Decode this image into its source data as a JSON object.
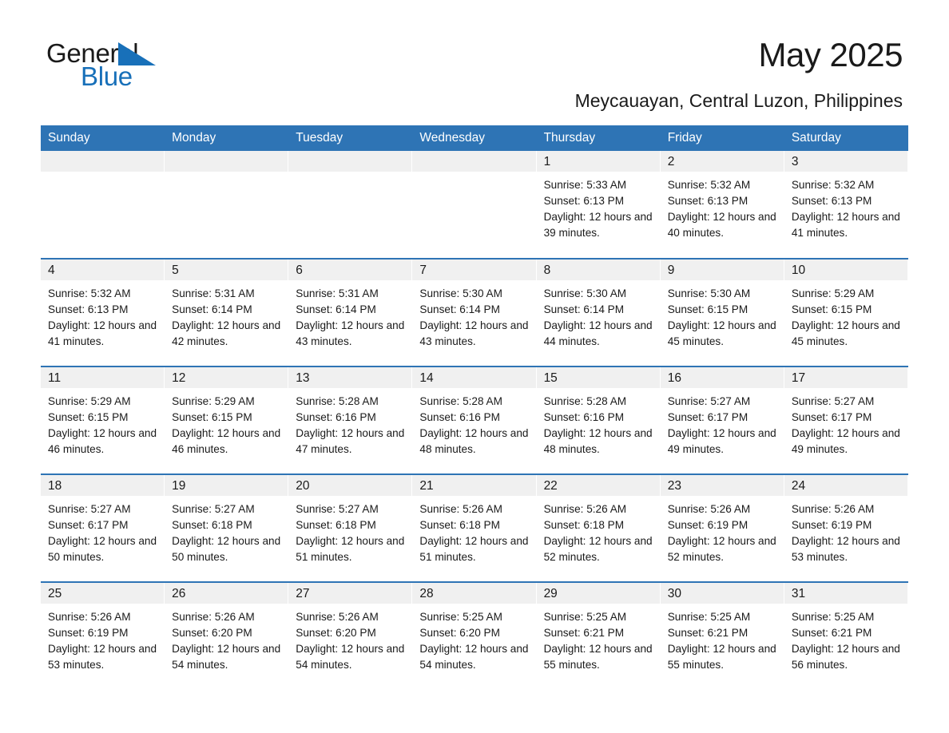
{
  "brand": {
    "name_part1": "General",
    "name_part2": "Blue",
    "triangle_color": "#1870b9"
  },
  "header": {
    "title": "May 2025",
    "subtitle": "Meycauayan, Central Luzon, Philippines",
    "accent_color": "#2e74b5"
  },
  "weekdays": [
    "Sunday",
    "Monday",
    "Tuesday",
    "Wednesday",
    "Thursday",
    "Friday",
    "Saturday"
  ],
  "weeks": [
    [
      {
        "day": "",
        "sunrise": "",
        "sunset": "",
        "daylight": ""
      },
      {
        "day": "",
        "sunrise": "",
        "sunset": "",
        "daylight": ""
      },
      {
        "day": "",
        "sunrise": "",
        "sunset": "",
        "daylight": ""
      },
      {
        "day": "",
        "sunrise": "",
        "sunset": "",
        "daylight": ""
      },
      {
        "day": "1",
        "sunrise": "Sunrise: 5:33 AM",
        "sunset": "Sunset: 6:13 PM",
        "daylight": "Daylight: 12 hours and 39 minutes."
      },
      {
        "day": "2",
        "sunrise": "Sunrise: 5:32 AM",
        "sunset": "Sunset: 6:13 PM",
        "daylight": "Daylight: 12 hours and 40 minutes."
      },
      {
        "day": "3",
        "sunrise": "Sunrise: 5:32 AM",
        "sunset": "Sunset: 6:13 PM",
        "daylight": "Daylight: 12 hours and 41 minutes."
      }
    ],
    [
      {
        "day": "4",
        "sunrise": "Sunrise: 5:32 AM",
        "sunset": "Sunset: 6:13 PM",
        "daylight": "Daylight: 12 hours and 41 minutes."
      },
      {
        "day": "5",
        "sunrise": "Sunrise: 5:31 AM",
        "sunset": "Sunset: 6:14 PM",
        "daylight": "Daylight: 12 hours and 42 minutes."
      },
      {
        "day": "6",
        "sunrise": "Sunrise: 5:31 AM",
        "sunset": "Sunset: 6:14 PM",
        "daylight": "Daylight: 12 hours and 43 minutes."
      },
      {
        "day": "7",
        "sunrise": "Sunrise: 5:30 AM",
        "sunset": "Sunset: 6:14 PM",
        "daylight": "Daylight: 12 hours and 43 minutes."
      },
      {
        "day": "8",
        "sunrise": "Sunrise: 5:30 AM",
        "sunset": "Sunset: 6:14 PM",
        "daylight": "Daylight: 12 hours and 44 minutes."
      },
      {
        "day": "9",
        "sunrise": "Sunrise: 5:30 AM",
        "sunset": "Sunset: 6:15 PM",
        "daylight": "Daylight: 12 hours and 45 minutes."
      },
      {
        "day": "10",
        "sunrise": "Sunrise: 5:29 AM",
        "sunset": "Sunset: 6:15 PM",
        "daylight": "Daylight: 12 hours and 45 minutes."
      }
    ],
    [
      {
        "day": "11",
        "sunrise": "Sunrise: 5:29 AM",
        "sunset": "Sunset: 6:15 PM",
        "daylight": "Daylight: 12 hours and 46 minutes."
      },
      {
        "day": "12",
        "sunrise": "Sunrise: 5:29 AM",
        "sunset": "Sunset: 6:15 PM",
        "daylight": "Daylight: 12 hours and 46 minutes."
      },
      {
        "day": "13",
        "sunrise": "Sunrise: 5:28 AM",
        "sunset": "Sunset: 6:16 PM",
        "daylight": "Daylight: 12 hours and 47 minutes."
      },
      {
        "day": "14",
        "sunrise": "Sunrise: 5:28 AM",
        "sunset": "Sunset: 6:16 PM",
        "daylight": "Daylight: 12 hours and 48 minutes."
      },
      {
        "day": "15",
        "sunrise": "Sunrise: 5:28 AM",
        "sunset": "Sunset: 6:16 PM",
        "daylight": "Daylight: 12 hours and 48 minutes."
      },
      {
        "day": "16",
        "sunrise": "Sunrise: 5:27 AM",
        "sunset": "Sunset: 6:17 PM",
        "daylight": "Daylight: 12 hours and 49 minutes."
      },
      {
        "day": "17",
        "sunrise": "Sunrise: 5:27 AM",
        "sunset": "Sunset: 6:17 PM",
        "daylight": "Daylight: 12 hours and 49 minutes."
      }
    ],
    [
      {
        "day": "18",
        "sunrise": "Sunrise: 5:27 AM",
        "sunset": "Sunset: 6:17 PM",
        "daylight": "Daylight: 12 hours and 50 minutes."
      },
      {
        "day": "19",
        "sunrise": "Sunrise: 5:27 AM",
        "sunset": "Sunset: 6:18 PM",
        "daylight": "Daylight: 12 hours and 50 minutes."
      },
      {
        "day": "20",
        "sunrise": "Sunrise: 5:27 AM",
        "sunset": "Sunset: 6:18 PM",
        "daylight": "Daylight: 12 hours and 51 minutes."
      },
      {
        "day": "21",
        "sunrise": "Sunrise: 5:26 AM",
        "sunset": "Sunset: 6:18 PM",
        "daylight": "Daylight: 12 hours and 51 minutes."
      },
      {
        "day": "22",
        "sunrise": "Sunrise: 5:26 AM",
        "sunset": "Sunset: 6:18 PM",
        "daylight": "Daylight: 12 hours and 52 minutes."
      },
      {
        "day": "23",
        "sunrise": "Sunrise: 5:26 AM",
        "sunset": "Sunset: 6:19 PM",
        "daylight": "Daylight: 12 hours and 52 minutes."
      },
      {
        "day": "24",
        "sunrise": "Sunrise: 5:26 AM",
        "sunset": "Sunset: 6:19 PM",
        "daylight": "Daylight: 12 hours and 53 minutes."
      }
    ],
    [
      {
        "day": "25",
        "sunrise": "Sunrise: 5:26 AM",
        "sunset": "Sunset: 6:19 PM",
        "daylight": "Daylight: 12 hours and 53 minutes."
      },
      {
        "day": "26",
        "sunrise": "Sunrise: 5:26 AM",
        "sunset": "Sunset: 6:20 PM",
        "daylight": "Daylight: 12 hours and 54 minutes."
      },
      {
        "day": "27",
        "sunrise": "Sunrise: 5:26 AM",
        "sunset": "Sunset: 6:20 PM",
        "daylight": "Daylight: 12 hours and 54 minutes."
      },
      {
        "day": "28",
        "sunrise": "Sunrise: 5:25 AM",
        "sunset": "Sunset: 6:20 PM",
        "daylight": "Daylight: 12 hours and 54 minutes."
      },
      {
        "day": "29",
        "sunrise": "Sunrise: 5:25 AM",
        "sunset": "Sunset: 6:21 PM",
        "daylight": "Daylight: 12 hours and 55 minutes."
      },
      {
        "day": "30",
        "sunrise": "Sunrise: 5:25 AM",
        "sunset": "Sunset: 6:21 PM",
        "daylight": "Daylight: 12 hours and 55 minutes."
      },
      {
        "day": "31",
        "sunrise": "Sunrise: 5:25 AM",
        "sunset": "Sunset: 6:21 PM",
        "daylight": "Daylight: 12 hours and 56 minutes."
      }
    ]
  ]
}
